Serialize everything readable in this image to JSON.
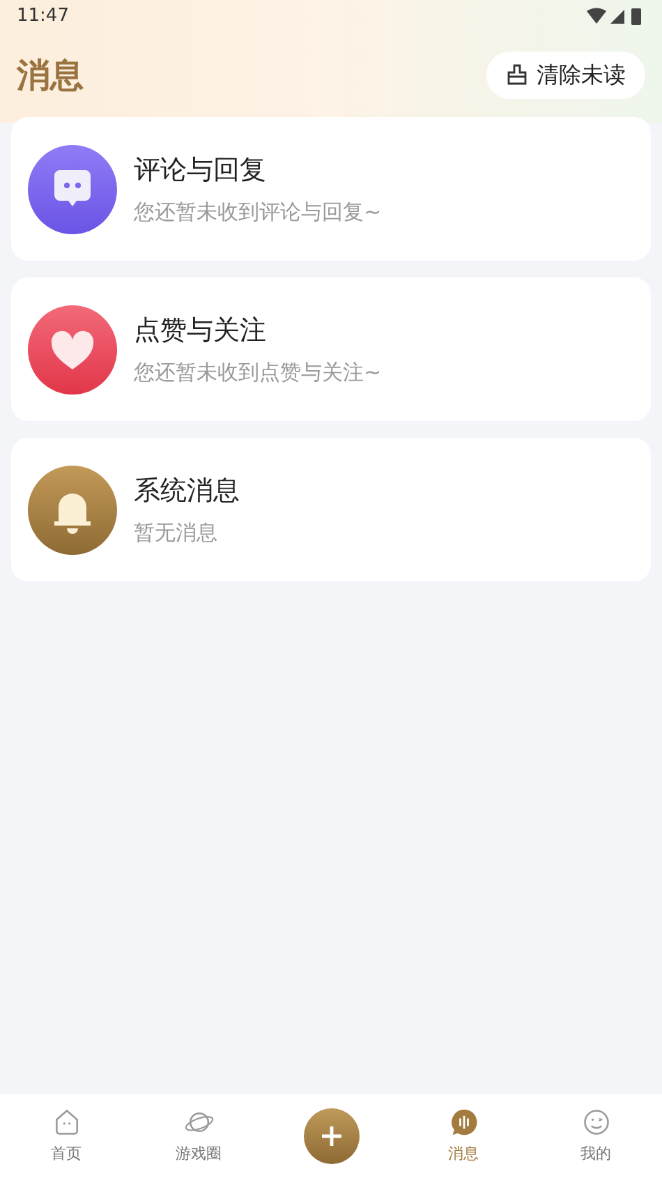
{
  "status_bar": {
    "time": "11:47"
  },
  "header": {
    "title": "消息",
    "clear_button": "清除未读"
  },
  "cards": [
    {
      "kind": "comment",
      "title": "评论与回复",
      "subtitle": "您还暂未收到评论与回复~"
    },
    {
      "kind": "like",
      "title": "点赞与关注",
      "subtitle": "您还暂未收到点赞与关注~"
    },
    {
      "kind": "system",
      "title": "系统消息",
      "subtitle": "暂无消息"
    }
  ],
  "bottom_nav": [
    {
      "kind": "home",
      "label": "首页",
      "selected": false
    },
    {
      "kind": "planet",
      "label": "游戏圈",
      "selected": false
    },
    {
      "kind": "add"
    },
    {
      "kind": "message",
      "label": "消息",
      "selected": true
    },
    {
      "kind": "me",
      "label": "我的",
      "selected": false
    }
  ]
}
